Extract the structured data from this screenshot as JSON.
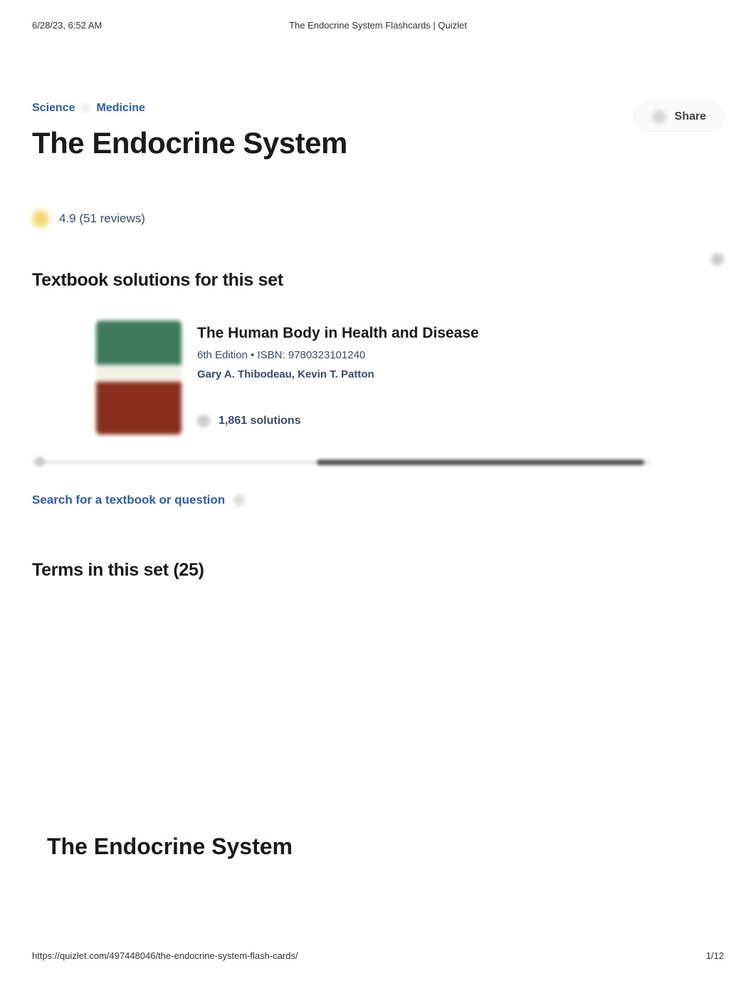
{
  "print": {
    "datetime": "6/28/23, 6:52 AM",
    "header_title": "The Endocrine System Flashcards | Quizlet",
    "footer_url": "https://quizlet.com/497448046/the-endocrine-system-flash-cards/",
    "page_number": "1/12"
  },
  "breadcrumb": {
    "items": [
      "Science",
      "Medicine"
    ]
  },
  "share": {
    "label": "Share"
  },
  "page_title": "The Endocrine System",
  "rating": {
    "value": "4.9",
    "reviews_text": "4.9 (51 reviews)"
  },
  "textbook_section": {
    "heading": "Textbook solutions for this set",
    "book": {
      "title": "The Human Body in Health and Disease",
      "edition_isbn": "6th Edition • ISBN: 9780323101240",
      "authors": "Gary A. Thibodeau, Kevin T. Patton",
      "solutions_count": "1,861 solutions"
    },
    "search_link": "Search for a textbook or question"
  },
  "terms": {
    "heading": "Terms in this set (25)"
  },
  "bottom_card": {
    "title": "The Endocrine System"
  }
}
